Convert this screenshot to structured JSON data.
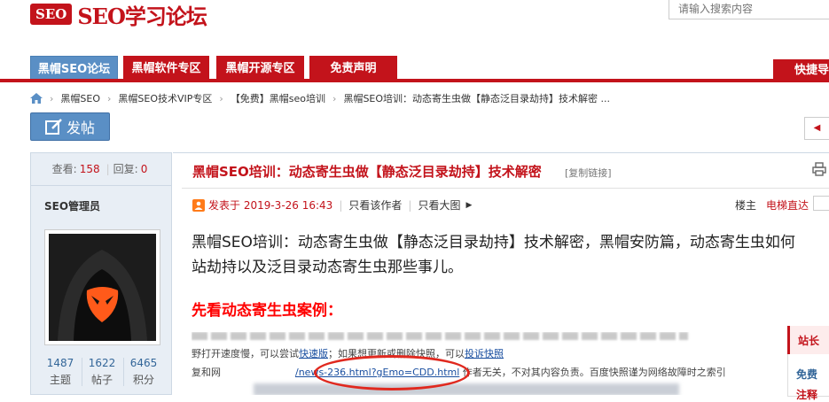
{
  "header": {
    "logo_badge": "SEO",
    "logo_text": "SEO学习论坛",
    "search_placeholder": "请输入搜索内容"
  },
  "nav": {
    "tabs": [
      "黑帽SEO论坛",
      "黑帽软件专区",
      "黑帽开源专区",
      "免责声明"
    ],
    "quick_nav": "快捷导"
  },
  "breadcrumb": [
    "黑帽SEO",
    "黑帽SEO技术VIP专区",
    "【免费】黑帽seo培训",
    "黑帽SEO培训：动态寄生虫做【静态泛目录劫持】技术解密 ..."
  ],
  "toolbar": {
    "post_label": "发帖",
    "back_glyph": "◀"
  },
  "thread": {
    "views_label": "查看:",
    "views": "158",
    "replies_label": "回复:",
    "replies": "0",
    "title": "黑帽SEO培训：动态寄生虫做【静态泛目录劫持】技术解密",
    "copy_link": "[复制链接]"
  },
  "author": {
    "name": "SEO管理员",
    "stats": [
      {
        "value": "1487",
        "label": "主题"
      },
      {
        "value": "1622",
        "label": "帖子"
      },
      {
        "value": "6465",
        "label": "积分"
      }
    ]
  },
  "post": {
    "posted_at": "发表于 2019-3-26 16:43",
    "only_author": "只看该作者",
    "view_large": "只看大图",
    "floor": "楼主",
    "jump": "电梯直达",
    "body_line1": "黑帽SEO培训：动态寄生虫做【静态泛目录劫持】技术解密，黑帽安防篇，动态寄生虫如何",
    "body_line2": "站劫持以及泛目录动态寄生虫那些事儿。",
    "subheading": "先看动态寄生虫案例：",
    "screenshot_line2_a": "野打开速度慢，可以尝试",
    "screenshot_link1": "快速版",
    "screenshot_line2_b": "；如果想更新或删除快照，可以",
    "screenshot_link2": "投诉快照",
    "screenshot_line3_a": "复和网",
    "screenshot_url": "/news-236.html?gEmo=CDD.html",
    "screenshot_line3_b": " 作者无关，不对其内容负责。百度快照谨为网络故障时之索引"
  },
  "sidebar_box": {
    "title": "站长",
    "item1": "免费",
    "item2": "注释"
  },
  "colors": {
    "brand_red": "#c3131b",
    "nav_blue": "#5a8fc5"
  }
}
